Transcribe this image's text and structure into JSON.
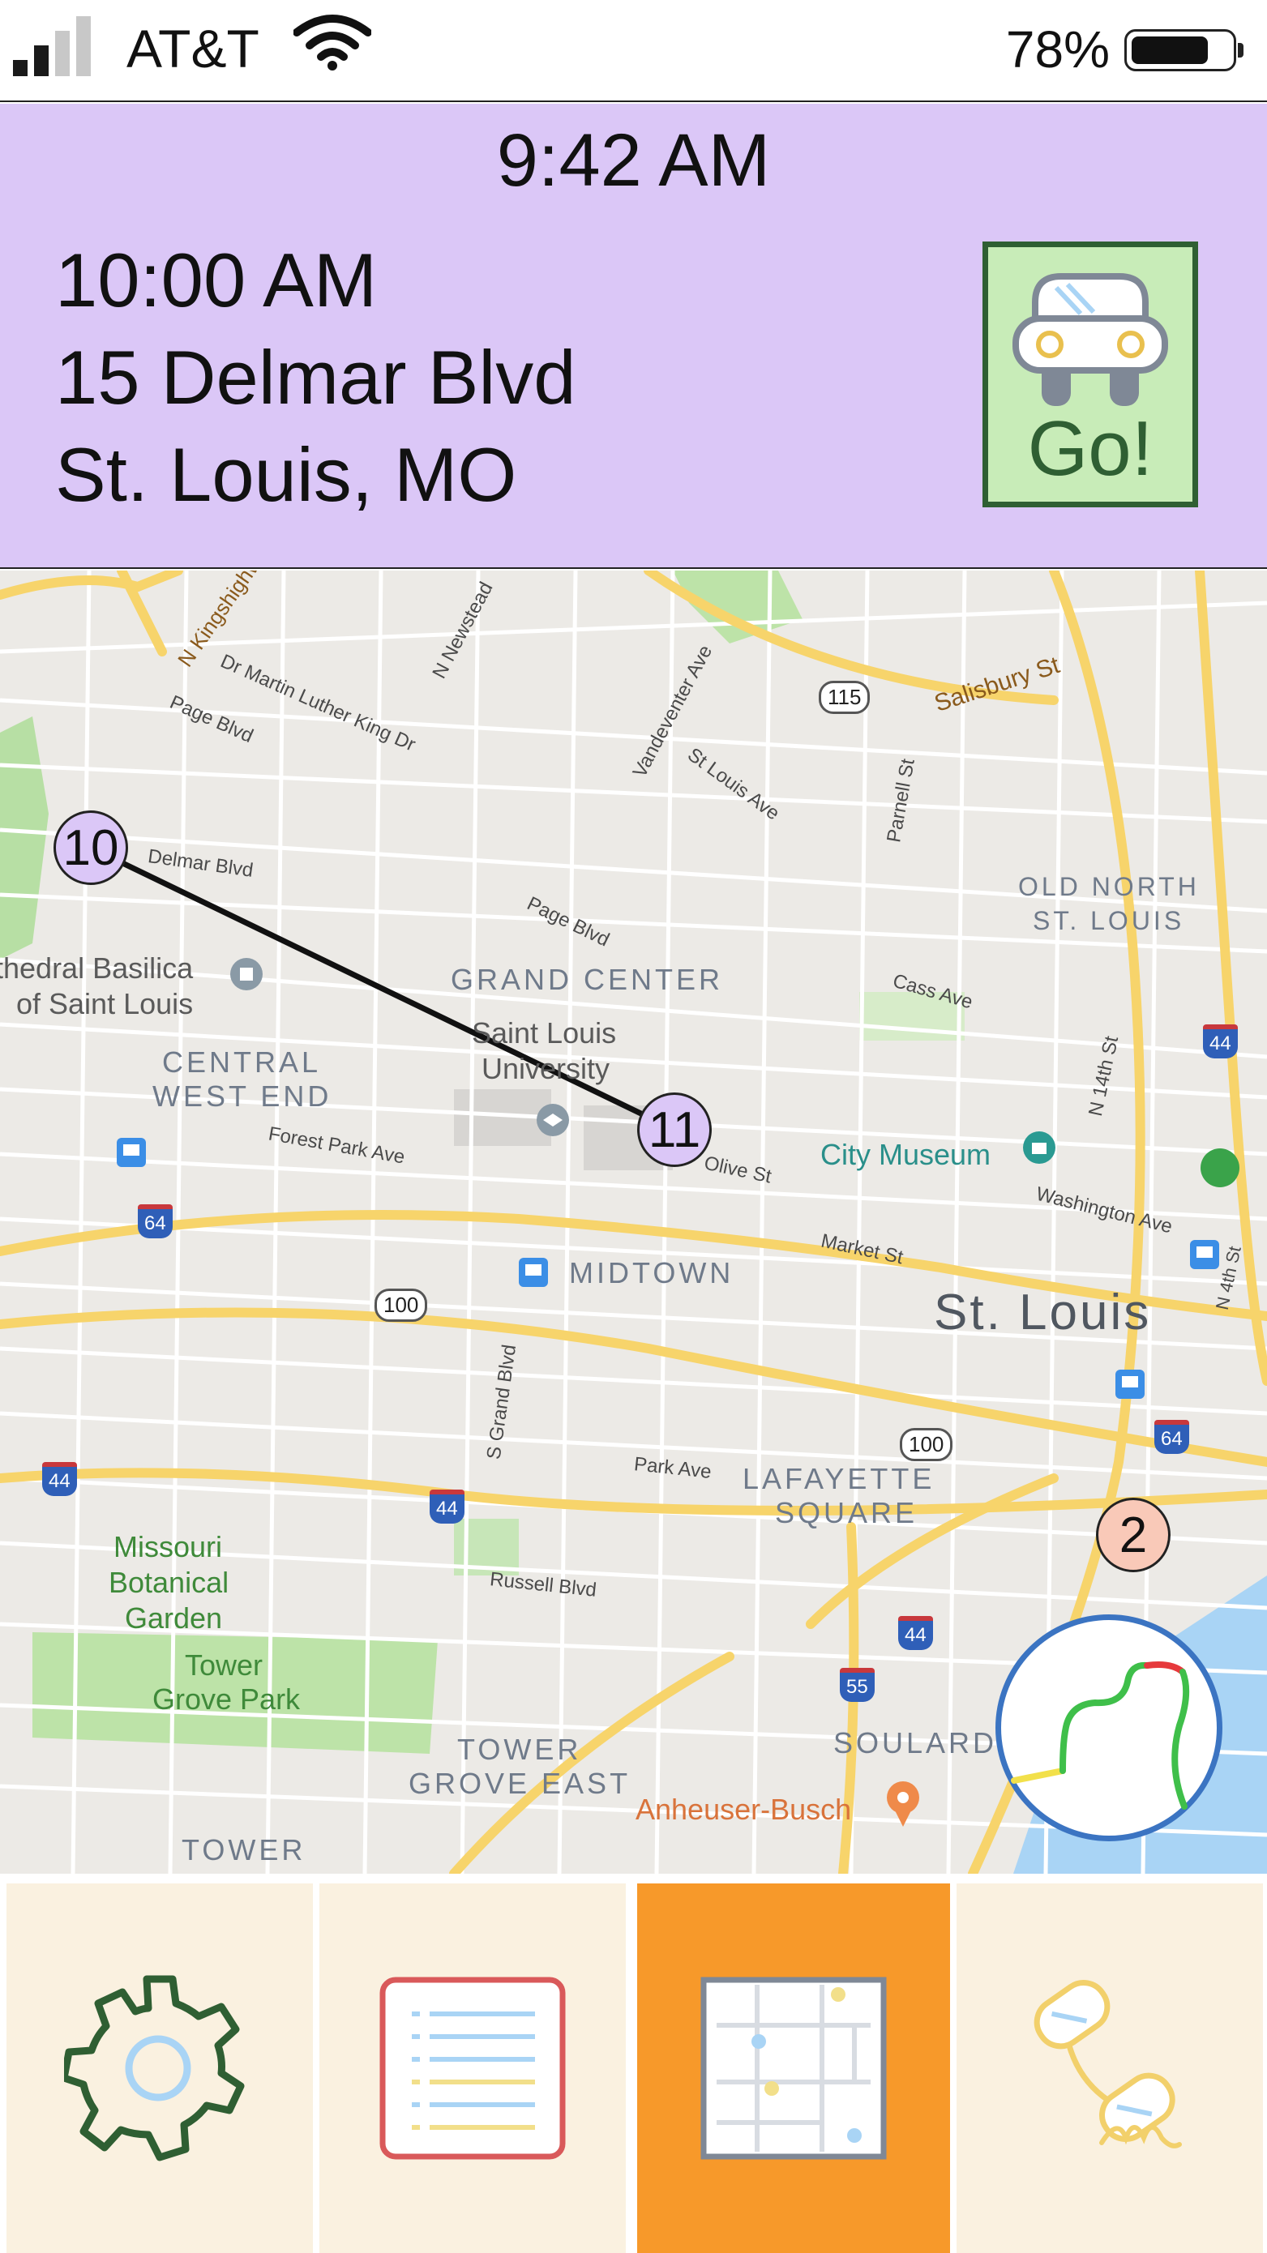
{
  "status_bar": {
    "carrier": "AT&T",
    "signal_bars": 2,
    "battery_percent_label": "78%",
    "battery_level": 0.78,
    "signal_icon": "signal-bars-icon",
    "wifi_icon": "wifi-icon",
    "battery_icon": "battery-icon"
  },
  "header": {
    "current_time": "9:42 AM",
    "appointment_time": "10:00 AM",
    "address_line1": "15 Delmar Blvd",
    "address_line2": "St. Louis, MO",
    "go_label": "Go!",
    "go_icon": "car-icon",
    "background_color": "#dbc7f7",
    "go_color": "#c8ecb8"
  },
  "map": {
    "streets": [
      "N Kingshighway",
      "Dr Martin Luther King Dr",
      "Page Blvd",
      "N Newstead",
      "Vandeventer Ave",
      "St Louis Ave",
      "Salisbury St",
      "Parnell St",
      "Delmar Blvd",
      "Cass Ave",
      "N 14th St",
      "Forest Park Ave",
      "Olive St",
      "Washington Ave",
      "Market St",
      "N 4th St",
      "S Grand Blvd",
      "Park Ave",
      "Russell Blvd"
    ],
    "highway_shields": [
      "115",
      "44",
      "64",
      "100",
      "100",
      "64",
      "44",
      "44",
      "44",
      "55"
    ],
    "neighborhoods": [
      "GRAND CENTER",
      "OLD NORTH",
      "ST. LOUIS",
      "CENTRAL",
      "WEST END",
      "MIDTOWN",
      "LAFAYETTE",
      "SQUARE",
      "TOWER",
      "GROVE EAST",
      "SOULARD",
      "TOWER"
    ],
    "city": "St. Louis",
    "pois": [
      "thedral Basilica",
      "of Saint Louis",
      "Saint Louis",
      "University",
      "City Museum",
      "Missouri",
      "Botanical",
      "Garden",
      "Tower",
      "Grove Park",
      "Anheuser-Busch"
    ],
    "markers": [
      {
        "label": "10",
        "color": "#dbc7f7"
      },
      {
        "label": "11",
        "color": "#dbc7f7"
      },
      {
        "label": "2",
        "color": "#f9c9b8"
      }
    ],
    "traffic_icon": "route-traffic-icon"
  },
  "nav": {
    "tabs": [
      {
        "name": "settings",
        "icon": "gear-icon",
        "active": false
      },
      {
        "name": "list",
        "icon": "list-icon",
        "active": false
      },
      {
        "name": "map",
        "icon": "map-icon",
        "active": true
      },
      {
        "name": "phone",
        "icon": "phone-icon",
        "active": false
      }
    ],
    "active_color": "#f7992a",
    "tab_color": "#faf1e0"
  }
}
